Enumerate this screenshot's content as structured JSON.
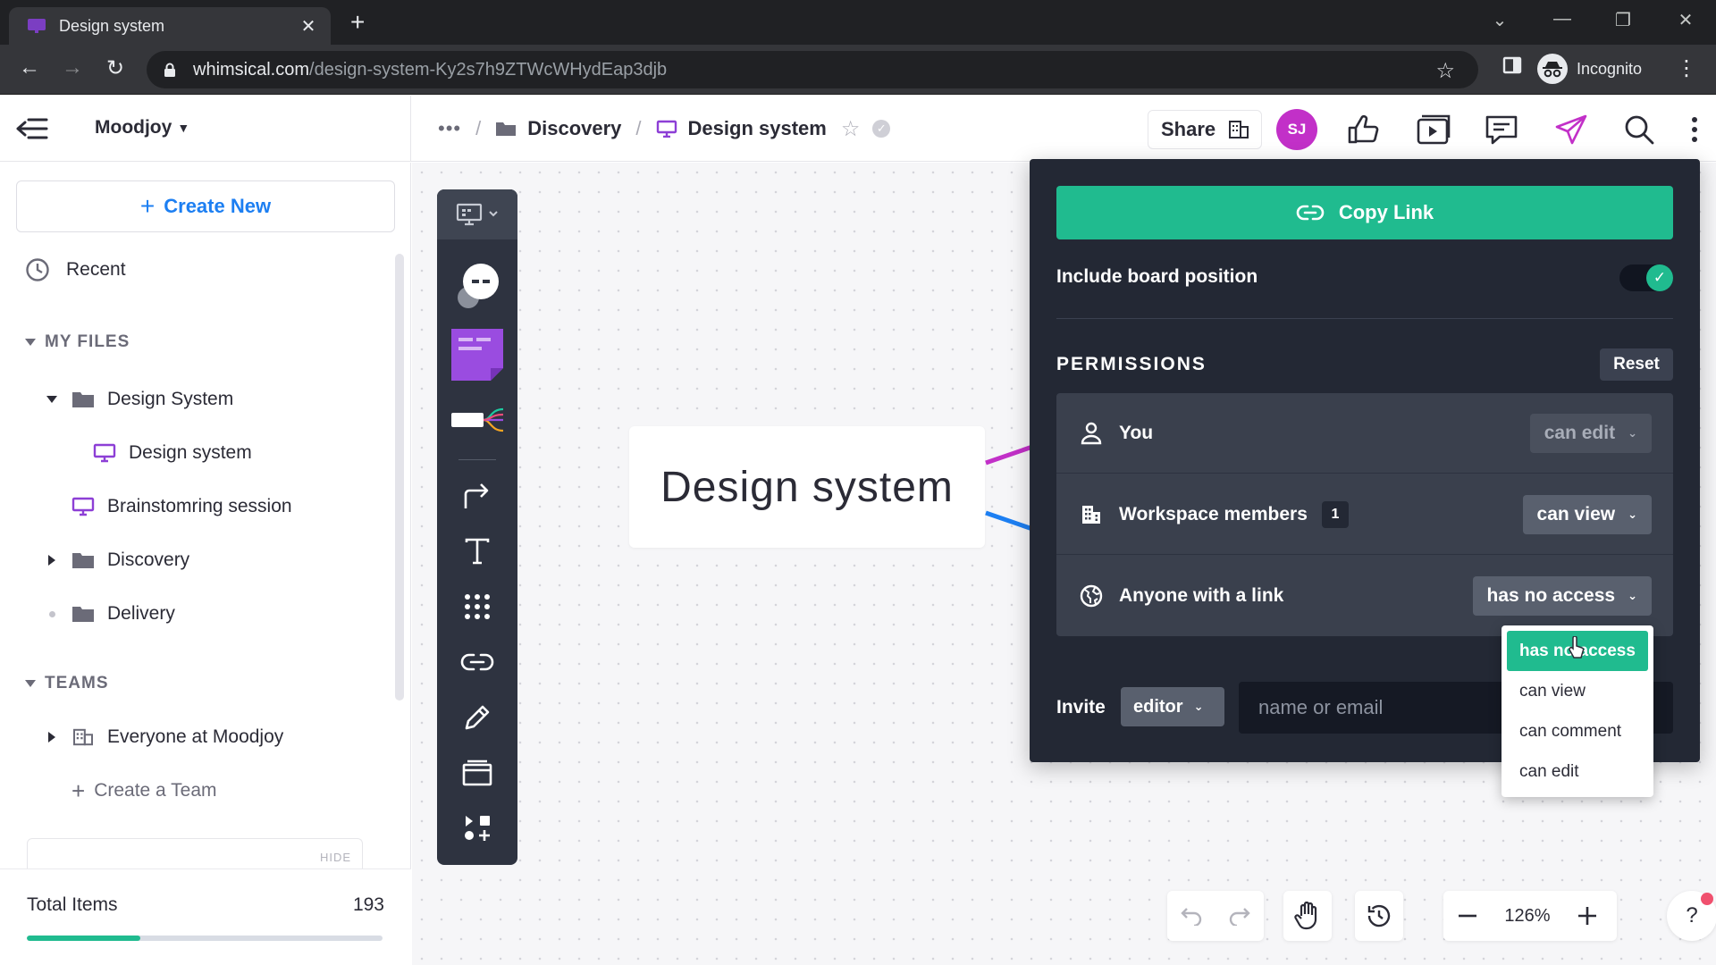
{
  "browser": {
    "tab_title": "Design system",
    "url_host": "whimsical.com",
    "url_path": "/design-system-Ky2s7h9ZTWcWHydEap3djb",
    "profile_label": "Incognito"
  },
  "header": {
    "workspace": "Moodjoy",
    "breadcrumb_folder": "Discovery",
    "breadcrumb_board": "Design system",
    "share_label": "Share",
    "avatar_initials": "SJ"
  },
  "sidebar": {
    "create_new": "Create New",
    "recent": "Recent",
    "my_files_title": "MY FILES",
    "files": [
      {
        "label": "Design System"
      },
      {
        "label": "Design system"
      },
      {
        "label": "Brainstomring session"
      },
      {
        "label": "Discovery"
      },
      {
        "label": "Delivery"
      }
    ],
    "teams_title": "TEAMS",
    "teams": [
      {
        "label": "Everyone at Moodjoy"
      }
    ],
    "create_team": "Create a Team",
    "hide_label": "HIDE",
    "total_items_label": "Total Items",
    "total_items_value": "193",
    "usage_fraction": 0.32
  },
  "canvas": {
    "board_title": "Design system",
    "zoom": "126%"
  },
  "share_panel": {
    "copy_link": "Copy Link",
    "include_position": "Include board position",
    "include_position_on": true,
    "permissions_title": "PERMISSIONS",
    "reset_label": "Reset",
    "rows": [
      {
        "label": "You",
        "value": "can edit"
      },
      {
        "label": "Workspace members",
        "count": "1",
        "value": "can view"
      },
      {
        "label": "Anyone with a link",
        "value": "has no access"
      }
    ],
    "invite_label": "Invite",
    "invite_role": "editor",
    "invite_placeholder": "name or email"
  },
  "dropdown": {
    "options": [
      "has no access",
      "can view",
      "can comment",
      "can edit"
    ],
    "selected": "has no access"
  },
  "colors": {
    "accent_green": "#20bb8f",
    "link_blue": "#1d7ff2",
    "avatar": "#c230c8",
    "board_purple": "#8d3fd6"
  }
}
